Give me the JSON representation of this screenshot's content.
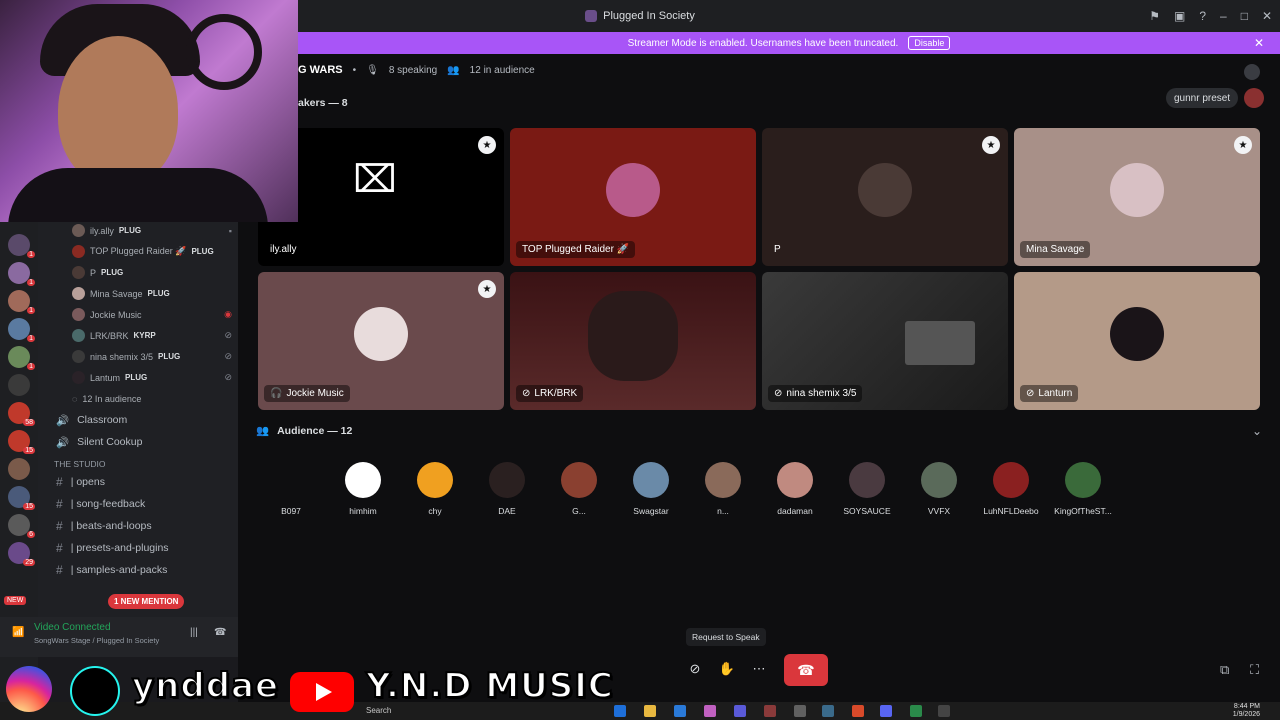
{
  "app": {
    "window_title": "Plugged In Society",
    "controls": [
      "flag-icon",
      "screen-icon",
      "help-icon",
      "minimize-icon",
      "maximize-icon",
      "close-icon"
    ]
  },
  "banner": {
    "text": "Streamer Mode is enabled. Usernames have been truncated.",
    "button": "Disable"
  },
  "stage": {
    "name": "G WARS",
    "speaking": "8 speaking",
    "audience": "12 in audience",
    "speakers_heading": "akers — 8",
    "preset_label": "gunnr preset"
  },
  "sidebar": {
    "voice_users": [
      {
        "name": "ily.ally",
        "tag": "PLUG"
      },
      {
        "name": "TOP Plugged Raider 🚀",
        "tag": "PLUG"
      },
      {
        "name": "P",
        "tag": "PLUG"
      },
      {
        "name": "Mina Savage",
        "tag": "PLUG"
      },
      {
        "name": "Jockie Music",
        "tag": ""
      },
      {
        "name": "LRK/BRK",
        "tag": "KYRP"
      },
      {
        "name": "nina shemix 3/5",
        "tag": "PLUG"
      },
      {
        "name": "Lantum",
        "tag": "PLUG"
      }
    ],
    "in_audience": "12 In audience",
    "voice_channels": [
      "Classroom",
      "Silent Cookup"
    ],
    "category": "THE STUDIO",
    "text_channels": [
      "| opens",
      "| song-feedback",
      "| beats-and-loops",
      "| presets-and-plugins",
      "| samples-and-packs"
    ],
    "new_label": "NEW",
    "mention_label": "1 NEW MENTION",
    "voice_status": "Video Connected",
    "voice_location": "SongWars Stage / Plugged In Society"
  },
  "tiles": [
    {
      "name": "ily.ally",
      "bg": "#000000"
    },
    {
      "name": "TOP Plugged Raider 🚀",
      "bg": "#7a1a14"
    },
    {
      "name": "P",
      "bg": "#2a1e1c"
    },
    {
      "name": "Mina Savage",
      "bg": "#a89088"
    },
    {
      "name": "Jockie Music",
      "bg": "#6a4a4c"
    },
    {
      "name": "LRK/BRK",
      "bg": "#3a1214"
    },
    {
      "name": "nina shemix 3/5",
      "bg": "#2a2a2a"
    },
    {
      "name": "Lanturn",
      "bg": "#b49a88"
    }
  ],
  "audience": {
    "heading": "Audience — 12",
    "members": [
      "B097",
      "himhim",
      "chy",
      "DAE",
      "G...",
      "Swagstar",
      "n...",
      "dadaman",
      "SOYSAUCE",
      "VVFX",
      "LuhNFLDeebo",
      "KingOfTheST..."
    ]
  },
  "controls": {
    "tooltip": "Request to Speak"
  },
  "overlay": {
    "handle": "ynddae",
    "channel": "Y.N.D MUSIC"
  },
  "taskbar": {
    "search": "Search",
    "time": "8:44 PM",
    "date": "1/9/2026"
  }
}
